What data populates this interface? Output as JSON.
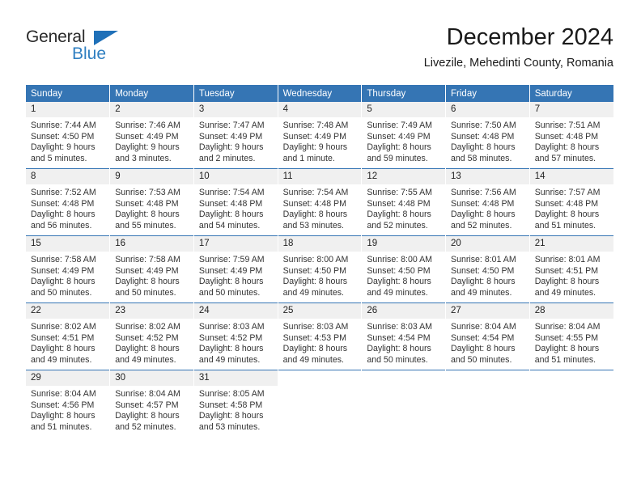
{
  "brand": {
    "name_top": "General",
    "name_bottom": "Blue",
    "flag_icon": "triangle-flag-icon",
    "color_primary": "#2f7fc1",
    "color_text": "#2a2a2a"
  },
  "header": {
    "month_title": "December 2024",
    "location": "Livezile, Mehedinti County, Romania"
  },
  "calendar": {
    "header_color": "#3575b4",
    "daynum_background": "#f0f0f0",
    "weekday_headers": [
      "Sunday",
      "Monday",
      "Tuesday",
      "Wednesday",
      "Thursday",
      "Friday",
      "Saturday"
    ],
    "weeks": [
      [
        {
          "day": "1",
          "sunrise": "Sunrise: 7:44 AM",
          "sunset": "Sunset: 4:50 PM",
          "daylight_line1": "Daylight: 9 hours",
          "daylight_line2": "and 5 minutes."
        },
        {
          "day": "2",
          "sunrise": "Sunrise: 7:46 AM",
          "sunset": "Sunset: 4:49 PM",
          "daylight_line1": "Daylight: 9 hours",
          "daylight_line2": "and 3 minutes."
        },
        {
          "day": "3",
          "sunrise": "Sunrise: 7:47 AM",
          "sunset": "Sunset: 4:49 PM",
          "daylight_line1": "Daylight: 9 hours",
          "daylight_line2": "and 2 minutes."
        },
        {
          "day": "4",
          "sunrise": "Sunrise: 7:48 AM",
          "sunset": "Sunset: 4:49 PM",
          "daylight_line1": "Daylight: 9 hours",
          "daylight_line2": "and 1 minute."
        },
        {
          "day": "5",
          "sunrise": "Sunrise: 7:49 AM",
          "sunset": "Sunset: 4:49 PM",
          "daylight_line1": "Daylight: 8 hours",
          "daylight_line2": "and 59 minutes."
        },
        {
          "day": "6",
          "sunrise": "Sunrise: 7:50 AM",
          "sunset": "Sunset: 4:48 PM",
          "daylight_line1": "Daylight: 8 hours",
          "daylight_line2": "and 58 minutes."
        },
        {
          "day": "7",
          "sunrise": "Sunrise: 7:51 AM",
          "sunset": "Sunset: 4:48 PM",
          "daylight_line1": "Daylight: 8 hours",
          "daylight_line2": "and 57 minutes."
        }
      ],
      [
        {
          "day": "8",
          "sunrise": "Sunrise: 7:52 AM",
          "sunset": "Sunset: 4:48 PM",
          "daylight_line1": "Daylight: 8 hours",
          "daylight_line2": "and 56 minutes."
        },
        {
          "day": "9",
          "sunrise": "Sunrise: 7:53 AM",
          "sunset": "Sunset: 4:48 PM",
          "daylight_line1": "Daylight: 8 hours",
          "daylight_line2": "and 55 minutes."
        },
        {
          "day": "10",
          "sunrise": "Sunrise: 7:54 AM",
          "sunset": "Sunset: 4:48 PM",
          "daylight_line1": "Daylight: 8 hours",
          "daylight_line2": "and 54 minutes."
        },
        {
          "day": "11",
          "sunrise": "Sunrise: 7:54 AM",
          "sunset": "Sunset: 4:48 PM",
          "daylight_line1": "Daylight: 8 hours",
          "daylight_line2": "and 53 minutes."
        },
        {
          "day": "12",
          "sunrise": "Sunrise: 7:55 AM",
          "sunset": "Sunset: 4:48 PM",
          "daylight_line1": "Daylight: 8 hours",
          "daylight_line2": "and 52 minutes."
        },
        {
          "day": "13",
          "sunrise": "Sunrise: 7:56 AM",
          "sunset": "Sunset: 4:48 PM",
          "daylight_line1": "Daylight: 8 hours",
          "daylight_line2": "and 52 minutes."
        },
        {
          "day": "14",
          "sunrise": "Sunrise: 7:57 AM",
          "sunset": "Sunset: 4:48 PM",
          "daylight_line1": "Daylight: 8 hours",
          "daylight_line2": "and 51 minutes."
        }
      ],
      [
        {
          "day": "15",
          "sunrise": "Sunrise: 7:58 AM",
          "sunset": "Sunset: 4:49 PM",
          "daylight_line1": "Daylight: 8 hours",
          "daylight_line2": "and 50 minutes."
        },
        {
          "day": "16",
          "sunrise": "Sunrise: 7:58 AM",
          "sunset": "Sunset: 4:49 PM",
          "daylight_line1": "Daylight: 8 hours",
          "daylight_line2": "and 50 minutes."
        },
        {
          "day": "17",
          "sunrise": "Sunrise: 7:59 AM",
          "sunset": "Sunset: 4:49 PM",
          "daylight_line1": "Daylight: 8 hours",
          "daylight_line2": "and 50 minutes."
        },
        {
          "day": "18",
          "sunrise": "Sunrise: 8:00 AM",
          "sunset": "Sunset: 4:50 PM",
          "daylight_line1": "Daylight: 8 hours",
          "daylight_line2": "and 49 minutes."
        },
        {
          "day": "19",
          "sunrise": "Sunrise: 8:00 AM",
          "sunset": "Sunset: 4:50 PM",
          "daylight_line1": "Daylight: 8 hours",
          "daylight_line2": "and 49 minutes."
        },
        {
          "day": "20",
          "sunrise": "Sunrise: 8:01 AM",
          "sunset": "Sunset: 4:50 PM",
          "daylight_line1": "Daylight: 8 hours",
          "daylight_line2": "and 49 minutes."
        },
        {
          "day": "21",
          "sunrise": "Sunrise: 8:01 AM",
          "sunset": "Sunset: 4:51 PM",
          "daylight_line1": "Daylight: 8 hours",
          "daylight_line2": "and 49 minutes."
        }
      ],
      [
        {
          "day": "22",
          "sunrise": "Sunrise: 8:02 AM",
          "sunset": "Sunset: 4:51 PM",
          "daylight_line1": "Daylight: 8 hours",
          "daylight_line2": "and 49 minutes."
        },
        {
          "day": "23",
          "sunrise": "Sunrise: 8:02 AM",
          "sunset": "Sunset: 4:52 PM",
          "daylight_line1": "Daylight: 8 hours",
          "daylight_line2": "and 49 minutes."
        },
        {
          "day": "24",
          "sunrise": "Sunrise: 8:03 AM",
          "sunset": "Sunset: 4:52 PM",
          "daylight_line1": "Daylight: 8 hours",
          "daylight_line2": "and 49 minutes."
        },
        {
          "day": "25",
          "sunrise": "Sunrise: 8:03 AM",
          "sunset": "Sunset: 4:53 PM",
          "daylight_line1": "Daylight: 8 hours",
          "daylight_line2": "and 49 minutes."
        },
        {
          "day": "26",
          "sunrise": "Sunrise: 8:03 AM",
          "sunset": "Sunset: 4:54 PM",
          "daylight_line1": "Daylight: 8 hours",
          "daylight_line2": "and 50 minutes."
        },
        {
          "day": "27",
          "sunrise": "Sunrise: 8:04 AM",
          "sunset": "Sunset: 4:54 PM",
          "daylight_line1": "Daylight: 8 hours",
          "daylight_line2": "and 50 minutes."
        },
        {
          "day": "28",
          "sunrise": "Sunrise: 8:04 AM",
          "sunset": "Sunset: 4:55 PM",
          "daylight_line1": "Daylight: 8 hours",
          "daylight_line2": "and 51 minutes."
        }
      ],
      [
        {
          "day": "29",
          "sunrise": "Sunrise: 8:04 AM",
          "sunset": "Sunset: 4:56 PM",
          "daylight_line1": "Daylight: 8 hours",
          "daylight_line2": "and 51 minutes."
        },
        {
          "day": "30",
          "sunrise": "Sunrise: 8:04 AM",
          "sunset": "Sunset: 4:57 PM",
          "daylight_line1": "Daylight: 8 hours",
          "daylight_line2": "and 52 minutes."
        },
        {
          "day": "31",
          "sunrise": "Sunrise: 8:05 AM",
          "sunset": "Sunset: 4:58 PM",
          "daylight_line1": "Daylight: 8 hours",
          "daylight_line2": "and 53 minutes."
        },
        {
          "day": "",
          "sunrise": "",
          "sunset": "",
          "daylight_line1": "",
          "daylight_line2": ""
        },
        {
          "day": "",
          "sunrise": "",
          "sunset": "",
          "daylight_line1": "",
          "daylight_line2": ""
        },
        {
          "day": "",
          "sunrise": "",
          "sunset": "",
          "daylight_line1": "",
          "daylight_line2": ""
        },
        {
          "day": "",
          "sunrise": "",
          "sunset": "",
          "daylight_line1": "",
          "daylight_line2": ""
        }
      ]
    ]
  }
}
